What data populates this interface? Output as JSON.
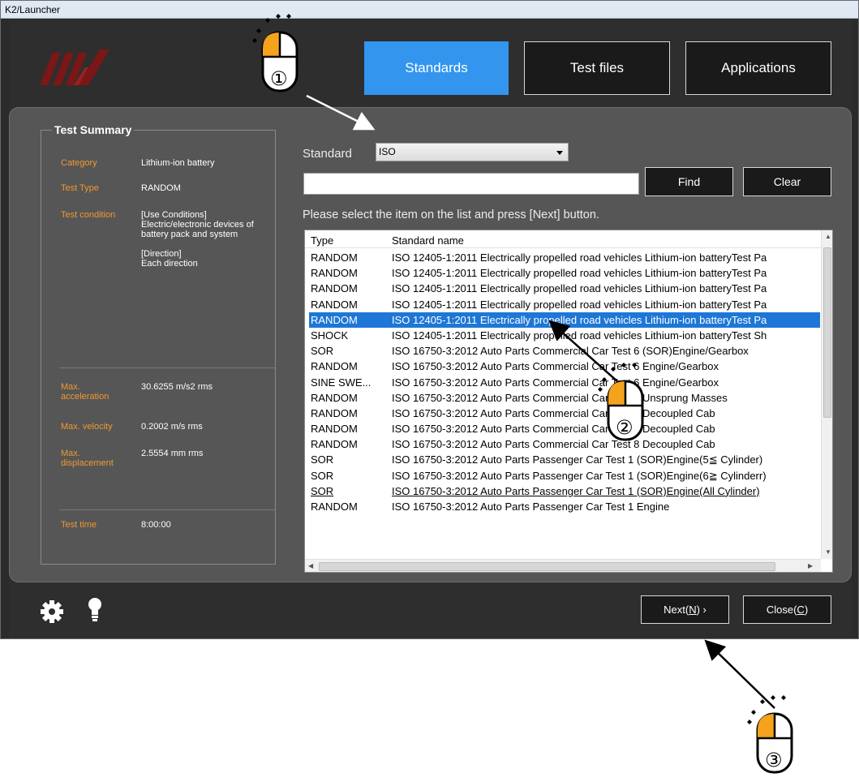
{
  "window": {
    "title": "K2/Launcher"
  },
  "nav": [
    {
      "label": "Standards",
      "active": true
    },
    {
      "label": "Test files",
      "active": false
    },
    {
      "label": "Applications",
      "active": false
    }
  ],
  "summary": {
    "title": "Test Summary",
    "rows": [
      {
        "label": "Category",
        "value": "Lithium-ion battery"
      },
      {
        "label": "Test Type",
        "value": "RANDOM"
      },
      {
        "label": "Test condition",
        "value": "[Use Conditions]\nElectric/electronic devices of battery pack and system\n\n[Direction]\nEach direction"
      },
      {
        "label": "Max.\nacceleration",
        "value": "30.6255 m/s2 rms"
      },
      {
        "label": "Max. velocity",
        "value": "0.2002 m/s rms"
      },
      {
        "label": "Max.\ndisplacement",
        "value": "2.5554 mm rms"
      },
      {
        "label": "Test time",
        "value": "8:00:00"
      }
    ]
  },
  "filter": {
    "standard_label": "Standard",
    "standard_value": "ISO",
    "search_value": "",
    "find_label": "Find",
    "clear_label": "Clear",
    "hint": "Please select the item on the list and press [Next] button."
  },
  "table": {
    "columns": [
      "Type",
      "Standard name"
    ],
    "rows": [
      {
        "type": "RANDOM",
        "name": "ISO 12405-1:2011 Electrically propelled road vehicles Lithium-ion batteryTest Pa"
      },
      {
        "type": "RANDOM",
        "name": "ISO 12405-1:2011 Electrically propelled road vehicles Lithium-ion batteryTest Pa"
      },
      {
        "type": "RANDOM",
        "name": "ISO 12405-1:2011 Electrically propelled road vehicles Lithium-ion batteryTest Pa"
      },
      {
        "type": "RANDOM",
        "name": "ISO 12405-1:2011 Electrically propelled road vehicles Lithium-ion batteryTest Pa"
      },
      {
        "type": "RANDOM",
        "name": "ISO 12405-1:2011 Electrically propelled road vehicles Lithium-ion batteryTest Pa",
        "selected": true
      },
      {
        "type": "SHOCK",
        "name": "ISO 12405-1:2011 Electrically propelled road vehicles Lithium-ion batteryTest Sh"
      },
      {
        "type": "SOR",
        "name": "ISO 16750-3:2012 Auto Parts Commercial Car Test 6 (SOR)Engine/Gearbox"
      },
      {
        "type": "RANDOM",
        "name": "ISO 16750-3:2012 Auto Parts Commercial Car Test 6 Engine/Gearbox"
      },
      {
        "type": "SINE SWE...",
        "name": "ISO 16750-3:2012 Auto Parts Commercial Car Test 6 Engine/Gearbox"
      },
      {
        "type": "RANDOM",
        "name": "ISO 16750-3:2012 Auto Parts Commercial Car Test 7 Unsprung Masses"
      },
      {
        "type": "RANDOM",
        "name": "ISO 16750-3:2012 Auto Parts Commercial Car Test 8 Decoupled Cab"
      },
      {
        "type": "RANDOM",
        "name": "ISO 16750-3:2012 Auto Parts Commercial Car Test 8 Decoupled Cab"
      },
      {
        "type": "RANDOM",
        "name": "ISO 16750-3:2012 Auto Parts Commercial Car Test 8 Decoupled Cab"
      },
      {
        "type": "SOR",
        "name": "ISO 16750-3:2012 Auto Parts Passenger Car Test 1 (SOR)Engine(5≦ Cylinder)"
      },
      {
        "type": "SOR",
        "name": "ISO 16750-3:2012 Auto Parts Passenger Car Test 1 (SOR)Engine(6≧ Cylinderr)"
      },
      {
        "type": "SOR",
        "name": "ISO 16750-3:2012 Auto Parts Passenger Car Test 1 (SOR)Engine(All Cylinder)",
        "underline": true
      },
      {
        "type": "RANDOM",
        "name": "ISO 16750-3:2012 Auto Parts Passenger Car Test 1 Engine"
      }
    ]
  },
  "footer": {
    "next_label": "Next(",
    "next_key": "N",
    "next_suffix": ") ›",
    "close_label": "Close(",
    "close_key": "C",
    "close_suffix": ")"
  },
  "annotations": {
    "step1": "①",
    "step2": "②",
    "step3": "③",
    "accent": "#f5a21c"
  },
  "colors": {
    "active_tab": "#3395ee",
    "selected_row": "#1e77d6",
    "summary_label": "#f09830",
    "logo": "#8b1a1a"
  }
}
